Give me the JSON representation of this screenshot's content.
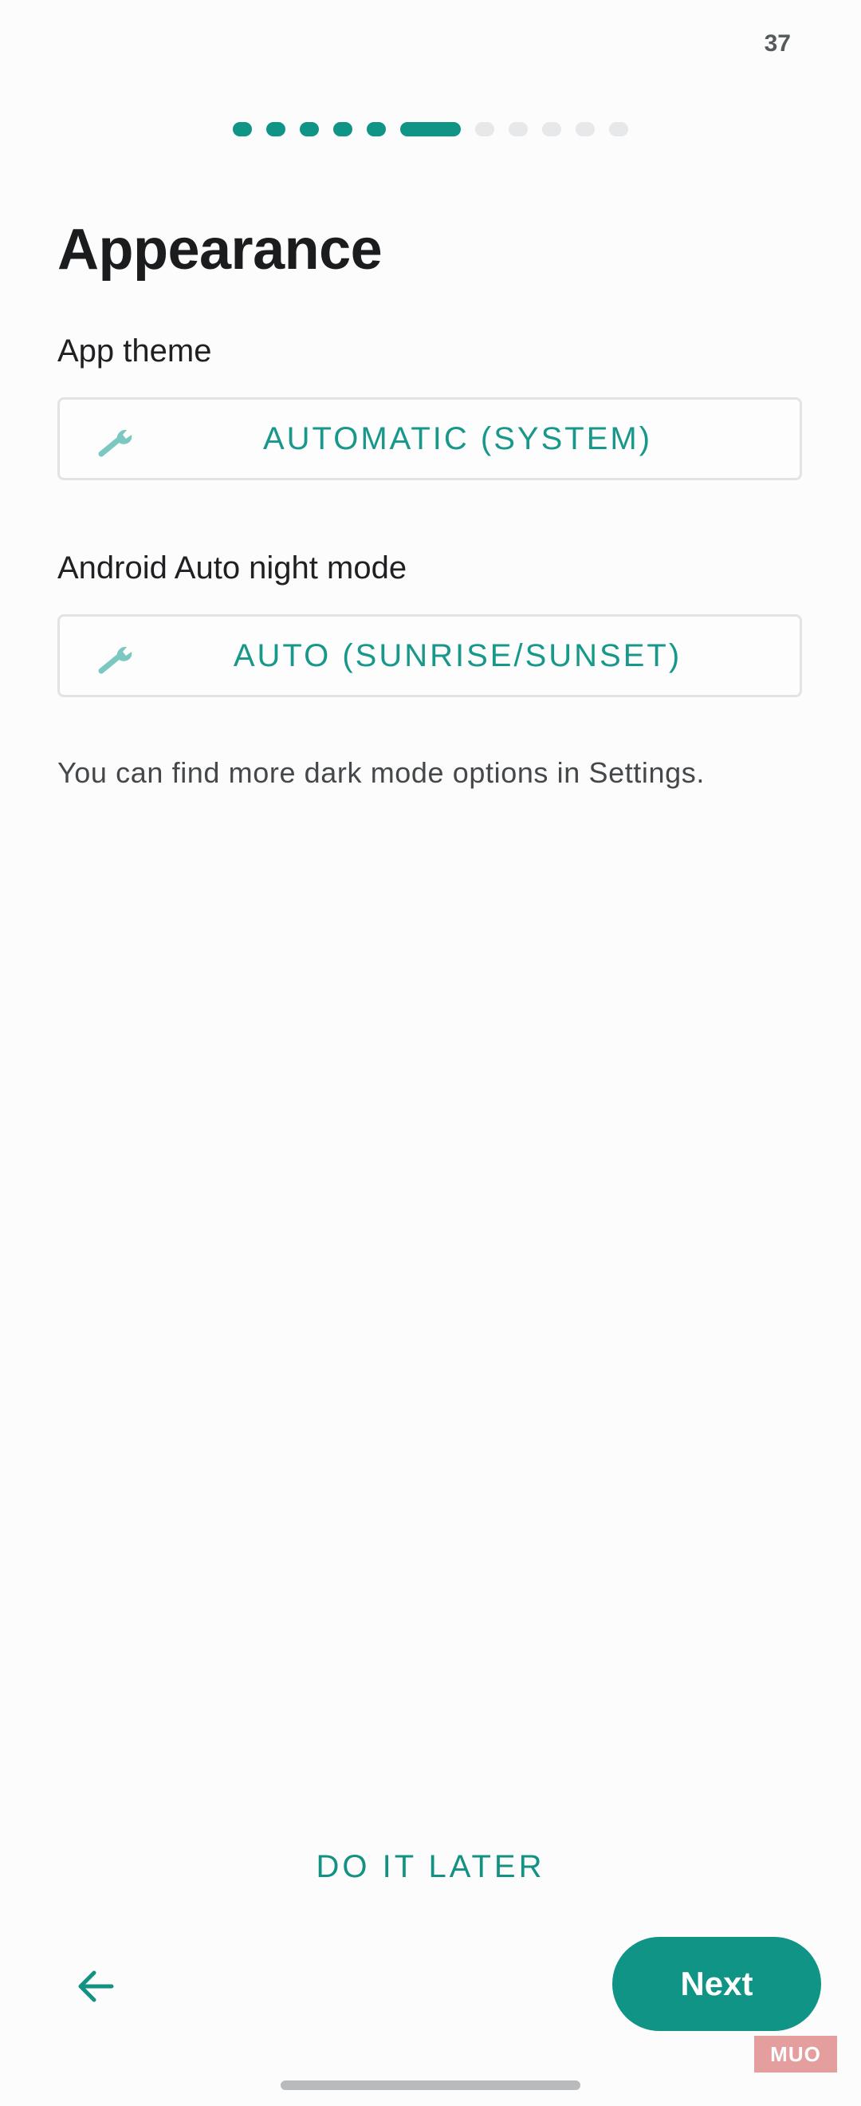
{
  "status_bar": {
    "battery_level": "37"
  },
  "progress": {
    "total_steps": 11,
    "current_step": 6
  },
  "page": {
    "title": "Appearance"
  },
  "app_theme": {
    "label": "App theme",
    "value": "AUTOMATIC (SYSTEM)",
    "icon": "wrench-icon"
  },
  "night_mode": {
    "label": "Android Auto night mode",
    "value": "AUTO (SUNRISE/SUNSET)",
    "icon": "wrench-icon"
  },
  "info": {
    "text": "You can find more dark mode options in Settings."
  },
  "actions": {
    "do_it_later": "DO IT LATER",
    "next": "Next",
    "back_icon": "arrow-left-icon"
  },
  "watermark": {
    "text": "MUO"
  },
  "colors": {
    "accent": "#0f9485",
    "text_primary": "#1b1c1e",
    "text_secondary": "#45484a"
  }
}
